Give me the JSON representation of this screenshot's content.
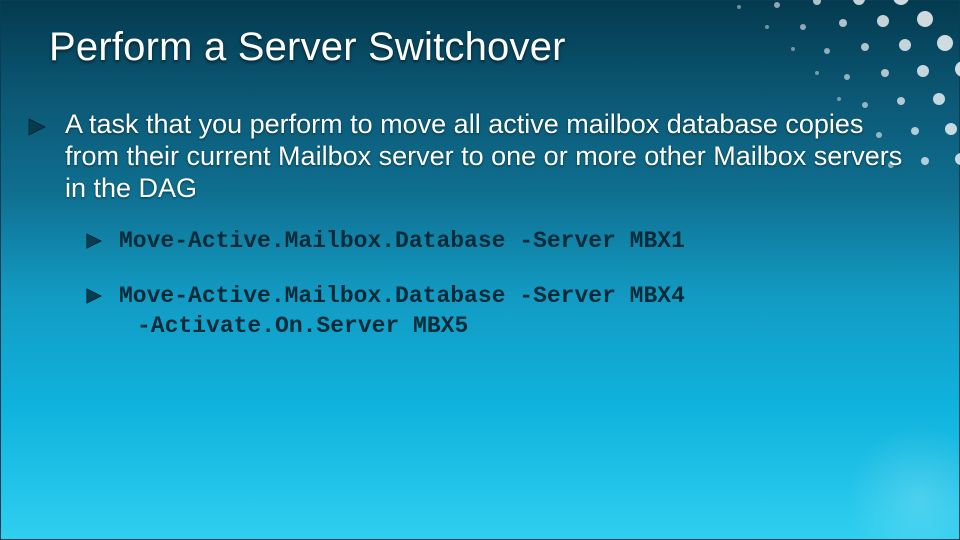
{
  "slide": {
    "title": "Perform a Server Switchover",
    "colors": {
      "bullet_fill_lvl1": "#063a4c",
      "bullet_stroke": "#052e3e",
      "bullet_fill_lvl2": "#083c4e",
      "code_color": "#022b3a"
    },
    "body": {
      "lead": "A task that you perform to move all active mailbox database copies from their current Mailbox server to one or more other Mailbox servers in the DAG",
      "commands": [
        {
          "line1": "Move-Active.Mailbox.Database -Server MBX1",
          "line2": ""
        },
        {
          "line1": "Move-Active.Mailbox.Database -Server MBX4",
          "line2": "-Activate.On.Server MBX5"
        }
      ]
    }
  }
}
